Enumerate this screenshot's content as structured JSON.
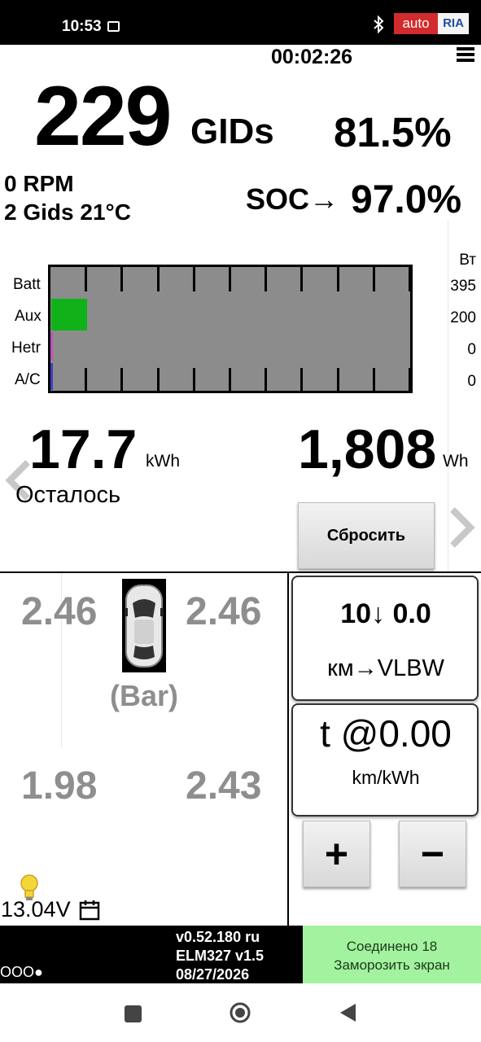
{
  "status_bar": {
    "time": "10:53",
    "watermark_left": "auto",
    "watermark_right": "RIA"
  },
  "header": {
    "timer": "00:02:26"
  },
  "gids": {
    "value": "229",
    "unit": "GIDs",
    "percent": "81.5%",
    "rpm": "0 RPM",
    "gids_temp": "2 Gids 21°C",
    "soc_label": "SOC→",
    "soc_value": "97.0%"
  },
  "power_chart": {
    "labels": [
      "Batt",
      "Aux",
      "Hetr",
      "A/C"
    ],
    "unit": "Вт",
    "watts": [
      "395",
      "200",
      "0",
      "0"
    ],
    "aux_fraction": 0.1,
    "colors": {
      "background": "#8c8c8c",
      "aux": "#11b11a"
    }
  },
  "energy": {
    "remaining_value": "17.7",
    "remaining_unit": "kWh",
    "remaining_label": "Осталось",
    "used_value": "1,808",
    "used_unit": "Wh",
    "reset_label": "Сбросить"
  },
  "tires": {
    "front_left": "2.46",
    "front_right": "2.46",
    "rear_left": "1.98",
    "rear_right": "2.43",
    "unit": "(Bar)"
  },
  "range_box": {
    "value": "10↓ 0.0",
    "label": "км→VLBW"
  },
  "efficiency_box": {
    "value": "t @0.00",
    "unit": "km/kWh"
  },
  "controls": {
    "plus": "+",
    "minus": "−"
  },
  "voltage": "13.04V",
  "bottom_bar": {
    "indicator": "OOO●",
    "version_line1": "v0.52.180 ru",
    "version_line2": "ELM327 v1.5",
    "version_line3": "08/27/2026",
    "connected_line1": "Соединено 18",
    "connected_line2": "Заморозить экран",
    "connected_color": "#a3f29f"
  }
}
